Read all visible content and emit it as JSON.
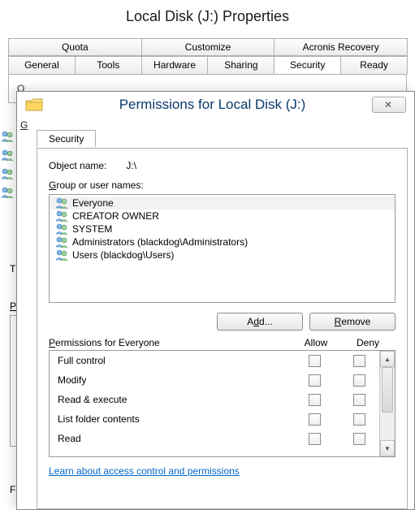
{
  "parent": {
    "title": "Local Disk (J:) Properties",
    "tabs_row1": [
      "Quota",
      "Customize",
      "Acronis Recovery"
    ],
    "tabs_row2": [
      "General",
      "Tools",
      "Hardware",
      "Sharing",
      "Security",
      "Ready"
    ],
    "active_tab": "Security"
  },
  "dialog": {
    "title": "Permissions for Local Disk (J:)",
    "tab": "Security",
    "object_label": "Object name:",
    "object_value": "J:\\",
    "group_label_rest": "roup or user names:",
    "groups": [
      {
        "name": "Everyone",
        "selected": true
      },
      {
        "name": "CREATOR OWNER",
        "selected": false
      },
      {
        "name": "SYSTEM",
        "selected": false
      },
      {
        "name": "Administrators (blackdog\\Administrators)",
        "selected": false
      },
      {
        "name": "Users (blackdog\\Users)",
        "selected": false
      }
    ],
    "add_pre": "A",
    "add_u": "d",
    "add_post": "d...",
    "remove_u": "R",
    "remove_rest": "emove",
    "perm_header_rest": "ermissions for Everyone",
    "allow": "Allow",
    "deny": "Deny",
    "permissions": [
      {
        "name": "Full control",
        "allow": false,
        "deny": false
      },
      {
        "name": "Modify",
        "allow": false,
        "deny": false
      },
      {
        "name": "Read & execute",
        "allow": false,
        "deny": false
      },
      {
        "name": "List folder contents",
        "allow": false,
        "deny": false
      },
      {
        "name": "Read",
        "allow": false,
        "deny": false
      }
    ],
    "learn_link": "Learn about access control and permissions"
  }
}
